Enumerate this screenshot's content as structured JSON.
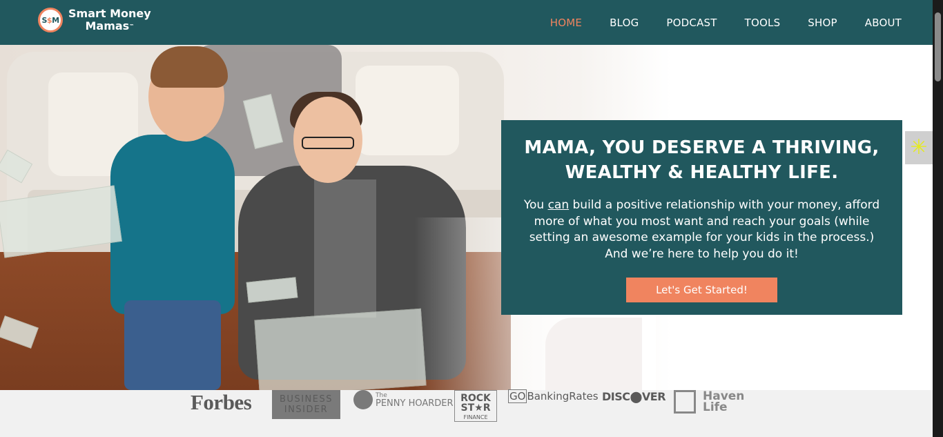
{
  "brand": {
    "badge_left": "S",
    "badge_mid": "$",
    "badge_right": "M",
    "name_line1": "Smart Money",
    "name_line2": "Mamas",
    "trademark": "™"
  },
  "nav": {
    "items": [
      {
        "label": "HOME",
        "active": true
      },
      {
        "label": "BLOG"
      },
      {
        "label": "PODCAST"
      },
      {
        "label": "TOOLS"
      },
      {
        "label": "SHOP"
      },
      {
        "label": "ABOUT"
      }
    ]
  },
  "hero": {
    "headline_line1": "MAMA, YOU DESERVE A THRIVING,",
    "headline_line2": "WEALTHY & HEALTHY LIFE.",
    "body_pre": "You ",
    "body_underlined": "can",
    "body_post": " build a positive relationship with your money, afford more of what you most want and reach your goals (while setting an awesome example for your kids in the process.) And we’re here to help you do it!",
    "cta_label": "Let's Get Started!"
  },
  "press": {
    "forbes": "Forbes",
    "business_insider_line1": "BUSINESS",
    "business_insider_line2": "INSIDER",
    "penny_the": "The",
    "penny_name": "PENNY HOARDER",
    "rockstar_line1": "ROCK",
    "rockstar_line2": "ST★R",
    "rockstar_line3": "FINANCE",
    "go": "GO",
    "banking_rates": "BankingRates",
    "discover": "DISC⬤VER",
    "haven_line1": "Haven",
    "haven_line2": "Life"
  },
  "colors": {
    "header_bg": "#21585e",
    "accent": "#f0845f",
    "press_bg": "#f1f1f1"
  },
  "icons": {
    "side_widget": "sun-icon"
  }
}
